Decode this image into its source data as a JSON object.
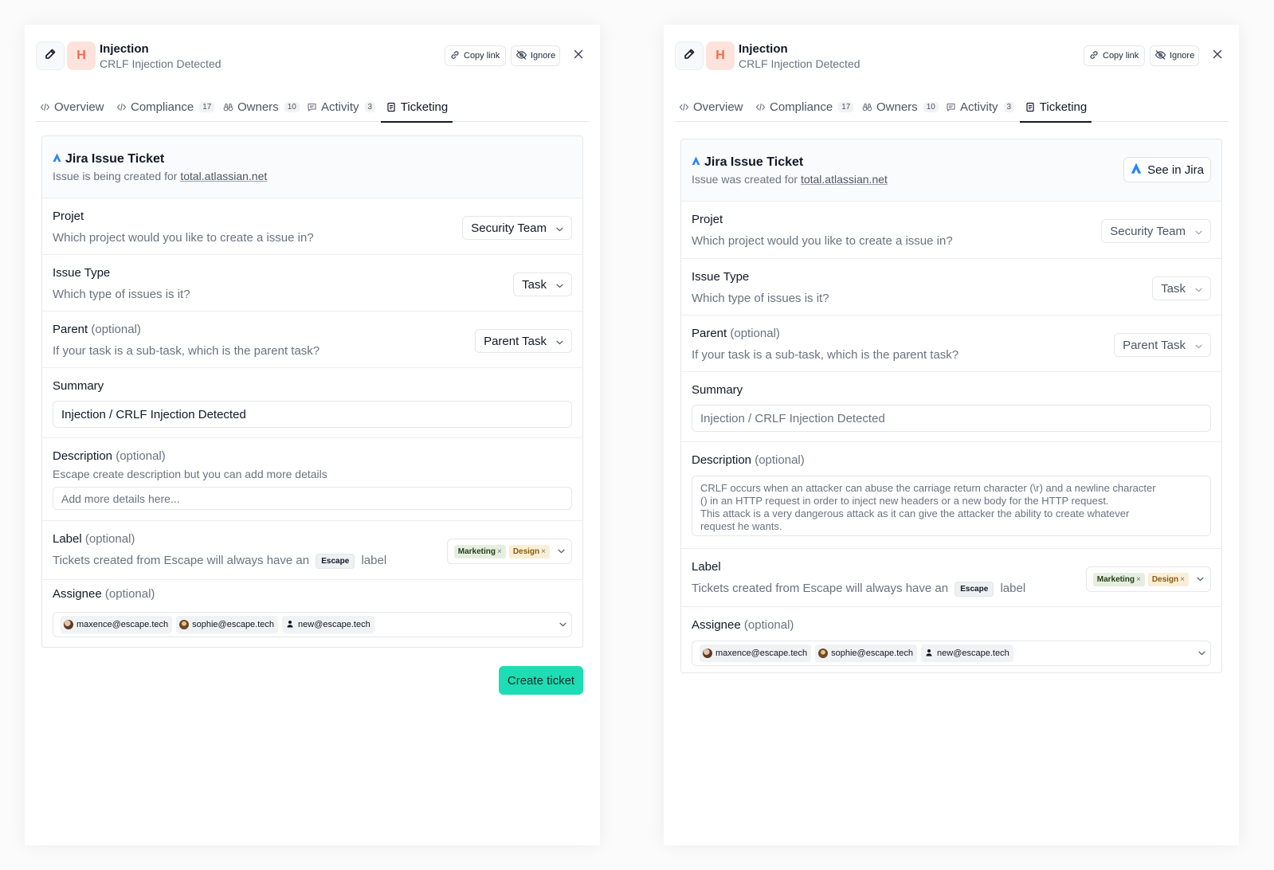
{
  "header": {
    "severity_letter": "H",
    "title": "Injection",
    "subtitle": "CRLF Injection Detected",
    "copy_link_label": "Copy link",
    "ignore_label": "Ignore"
  },
  "tabs": {
    "overview": {
      "label": "Overview"
    },
    "compliance": {
      "label": "Compliance",
      "count": "17"
    },
    "owners": {
      "label": "Owners",
      "count": "10"
    },
    "activity": {
      "label": "Activity",
      "count": "3"
    },
    "ticketing": {
      "label": "Ticketing"
    }
  },
  "ticket": {
    "title": "Jira Issue Ticket",
    "creating_prefix": "Issue is being created for",
    "created_prefix": "Issue was created for",
    "site": "total.atlassian.net",
    "see_in_jira_label": "See in Jira",
    "project": {
      "title": "Projet",
      "desc": "Which project would you like to create a issue in?",
      "value": "Security Team"
    },
    "issue_type": {
      "title": "Issue Type",
      "desc": "Which type of issues is it?",
      "value": "Task"
    },
    "parent": {
      "title": "Parent",
      "optional": "(optional)",
      "desc": "If your task is a sub-task, which is the parent task?",
      "value": "Parent Task"
    },
    "summary": {
      "title": "Summary",
      "value": "Injection / CRLF Injection Detected"
    },
    "description": {
      "title": "Description",
      "optional": "(optional)",
      "desc": "Escape create description but you can add more details",
      "placeholder": "Add more details here...",
      "value_line1": "CRLF occurs when an attacker can abuse the carriage return character (\\r) and a newline character",
      "value_line2": "() in an HTTP request in order to inject new headers or a new body for the HTTP request.",
      "value_line3": "This attack is a very dangerous attack as it can give the attacker the ability to create whatever",
      "value_line4": "request he wants."
    },
    "label": {
      "title": "Label",
      "optional": "(optional)",
      "desc_prefix": "Tickets created from Escape will always have an",
      "tag": "Escape",
      "desc_suffix": "label",
      "chips": [
        "Marketing",
        "Design"
      ]
    },
    "assignee": {
      "title": "Assignee",
      "optional": "(optional)",
      "people": [
        "maxence@escape.tech",
        "sophie@escape.tech",
        "new@escape.tech"
      ]
    },
    "create_label": "Create ticket"
  },
  "colors": {
    "accent_create": "#1edcb3",
    "severity_bg": "#fde3dc",
    "severity_fg": "#f06a4d",
    "jira_blue": "#2684ff"
  }
}
